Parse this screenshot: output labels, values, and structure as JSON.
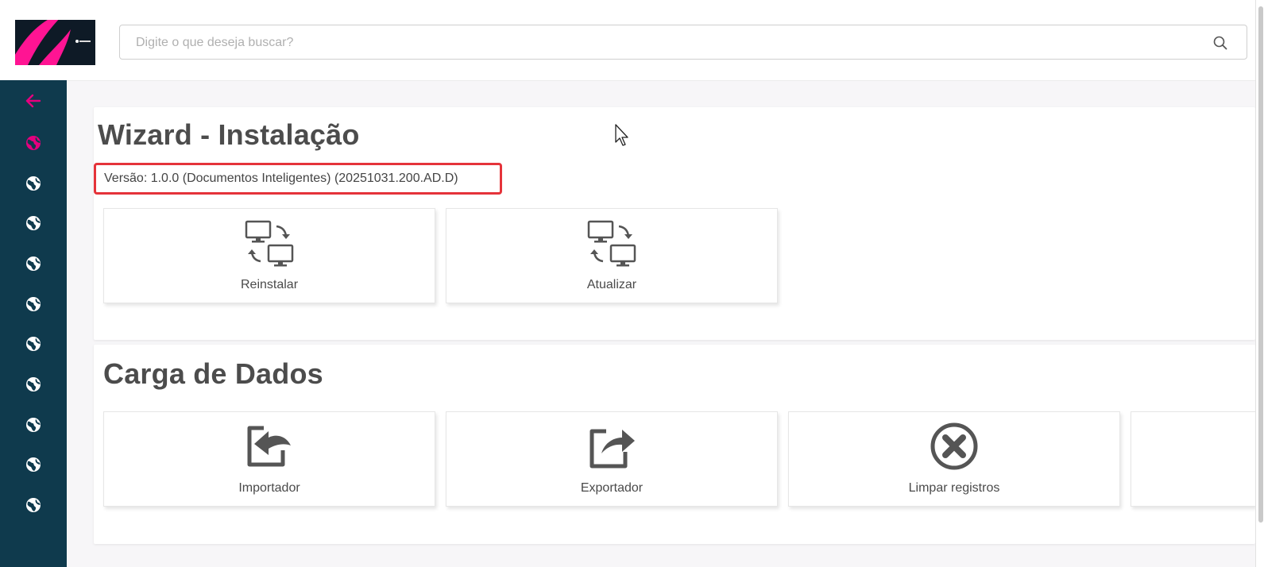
{
  "header": {
    "search": {
      "placeholder": "Digite o que deseja buscar?",
      "value": ""
    }
  },
  "sidebar": {
    "items": [
      {
        "icon": "arrow-left-icon"
      },
      {
        "icon": "globe-icon",
        "active": true
      },
      {
        "icon": "globe-icon"
      },
      {
        "icon": "globe-icon"
      },
      {
        "icon": "globe-icon"
      },
      {
        "icon": "globe-icon"
      },
      {
        "icon": "globe-icon"
      },
      {
        "icon": "globe-icon"
      },
      {
        "icon": "globe-icon"
      },
      {
        "icon": "globe-icon"
      },
      {
        "icon": "globe-icon"
      }
    ]
  },
  "wizard": {
    "title": "Wizard - Instalação",
    "version": "Versão: 1.0.0 (Documentos Inteligentes) (20251031.200.AD.D)",
    "actions": [
      {
        "label": "Reinstalar",
        "icon": "computer-sync-icon"
      },
      {
        "label": "Atualizar",
        "icon": "computer-sync-icon"
      }
    ]
  },
  "carga": {
    "title": "Carga de Dados",
    "actions": [
      {
        "label": "Importador",
        "icon": "import-icon"
      },
      {
        "label": "Exportador",
        "icon": "export-icon"
      },
      {
        "label": "Limpar registros",
        "icon": "clear-circle-x-icon"
      }
    ]
  },
  "colors": {
    "sidebar": "#0f3a4d",
    "accent": "#e5007e",
    "highlight_border": "#e5333a",
    "text": "#4a4a4a"
  }
}
